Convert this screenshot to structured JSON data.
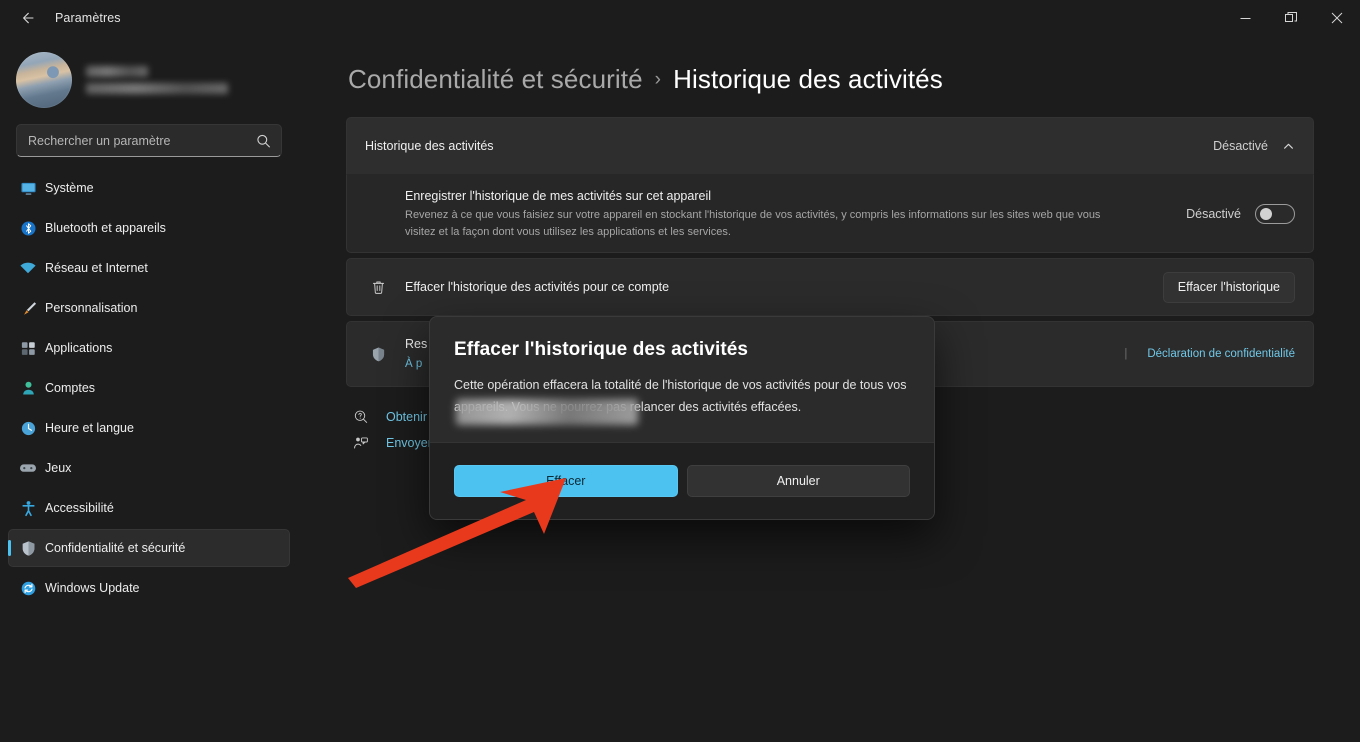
{
  "window": {
    "app_title": "Paramètres",
    "back_icon": "back-arrow-icon",
    "minimize_label": "—",
    "maximize_label": "❐",
    "close_label": "✕"
  },
  "sidebar": {
    "profile": {
      "avatar_icon": "user-avatar-photo",
      "name_redacted": true
    },
    "search": {
      "placeholder": "Rechercher un paramètre",
      "value": "",
      "icon": "search-icon"
    },
    "items": [
      {
        "label": "Système",
        "icon": "display-icon",
        "color": "#4aa3d8",
        "active": false
      },
      {
        "label": "Bluetooth et appareils",
        "icon": "bluetooth-icon",
        "color": "#1e7bd6",
        "active": false
      },
      {
        "label": "Réseau et Internet",
        "icon": "wifi-icon",
        "color": "#3fa9d8",
        "active": false
      },
      {
        "label": "Personnalisation",
        "icon": "paintbrush-icon",
        "color": "#e09a3e",
        "active": false
      },
      {
        "label": "Applications",
        "icon": "apps-grid-icon",
        "color": "#9aa4ad",
        "active": false
      },
      {
        "label": "Comptes",
        "icon": "account-person-icon",
        "color": "#3fbf9a",
        "active": false
      },
      {
        "label": "Heure et langue",
        "icon": "clock-icon",
        "color": "#4aa3d8",
        "active": false
      },
      {
        "label": "Jeux",
        "icon": "gamepad-icon",
        "color": "#9aa4ad",
        "active": false
      },
      {
        "label": "Accessibilité",
        "icon": "accessibility-person-icon",
        "color": "#38a8e0",
        "active": false
      },
      {
        "label": "Confidentialité et sécurité",
        "icon": "shield-icon",
        "color": "#b9c2cb",
        "active": true
      },
      {
        "label": "Windows Update",
        "icon": "update-refresh-icon",
        "color": "#2f9fe0",
        "active": false
      }
    ]
  },
  "breadcrumb": {
    "parent": "Confidentialité et sécurité",
    "separator": "›",
    "current": "Historique des activités"
  },
  "main": {
    "expander": {
      "title": "Historique des activités",
      "state": "Désactivé",
      "chevron_icon": "chevron-up-icon"
    },
    "device_history": {
      "title": "Enregistrer l'historique de mes activités sur cet appareil",
      "description": "Revenez à ce que vous faisiez sur votre appareil en stockant l'historique de vos activités, y compris les informations sur les sites web que vous visitez et la façon dont vous utilisez les applications et les services.",
      "toggle_state": "Désactivé",
      "toggle_on": false
    },
    "clear_history": {
      "icon": "trash-icon",
      "title": "Effacer l'historique des activités pour ce compte",
      "button_label": "Effacer l'historique"
    },
    "resources": {
      "icon": "shield-icon",
      "title": "Res",
      "subtitle": "À p",
      "separator": "|",
      "privacy_link": "Déclaration de confidentialité"
    },
    "footer_links": [
      {
        "label": "Obtenir",
        "icon": "help-question-icon"
      },
      {
        "label": "Envoyer",
        "icon": "feedback-icon"
      }
    ]
  },
  "dialog": {
    "title": "Effacer l'historique des activités",
    "body_line1": "Cette opération effacera la totalité de l'historique de vos activités pour",
    "body_line2": "de tous vos appareils. Vous ne pourrez pas relancer des",
    "body_line3": "activités effacées.",
    "confirm_label": "Effacer",
    "cancel_label": "Annuler",
    "accent_color": "#4cc2f1"
  },
  "annotation": {
    "arrow_color": "#e8391c",
    "points_to": "Effacer"
  }
}
